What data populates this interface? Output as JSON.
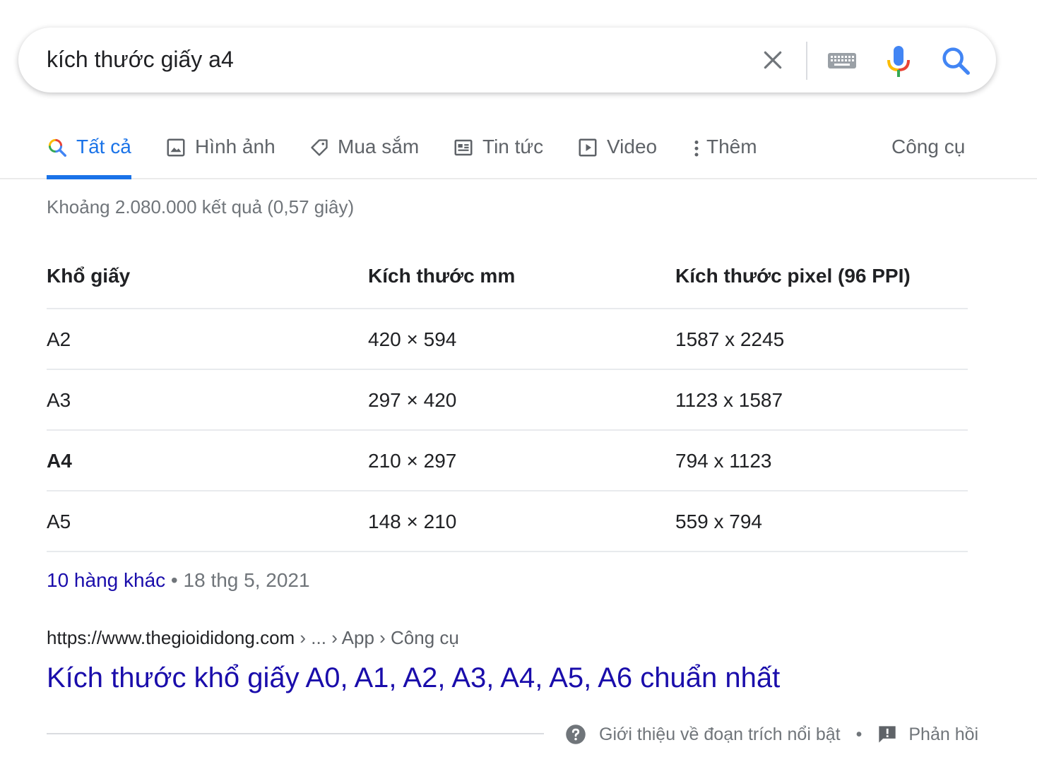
{
  "search": {
    "query": "kích thước giấy a4"
  },
  "icons": {
    "clear": "close-icon",
    "keyboard": "keyboard-icon",
    "mic": "microphone-icon",
    "search": "search-icon"
  },
  "colors": {
    "accent": "#1a73e8",
    "link": "#1a0dab",
    "muted": "#70757a",
    "mic_red": "#ea4335",
    "mic_blue": "#4285f4",
    "mic_green": "#34a853",
    "mic_yellow": "#fbbc05"
  },
  "tabs": [
    {
      "label": "Tất cả",
      "icon": "search-icon",
      "active": true
    },
    {
      "label": "Hình ảnh",
      "icon": "image-icon"
    },
    {
      "label": "Mua sắm",
      "icon": "tag-icon"
    },
    {
      "label": "Tin tức",
      "icon": "news-icon"
    },
    {
      "label": "Video",
      "icon": "play-icon"
    },
    {
      "label": "Thêm",
      "icon": "more-vert-icon"
    },
    {
      "label": "Công cụ"
    }
  ],
  "stats": "Khoảng 2.080.000 kết quả (0,57 giây)",
  "table": {
    "headers": [
      "Khổ giấy",
      "Kích thước mm",
      "Kích thước pixel (96 PPI)"
    ],
    "rows": [
      [
        "A2",
        "420 × 594",
        "1587 x 2245"
      ],
      [
        "A3",
        "297 × 420",
        "1123 x 1587"
      ],
      [
        "A4",
        "210 × 297",
        "794 x 1123"
      ],
      [
        "A5",
        "148 × 210",
        "559 x 794"
      ]
    ]
  },
  "more_rows": {
    "link": "10 hàng khác",
    "separator": "•",
    "date": "18 thg 5, 2021"
  },
  "result": {
    "url": "https://www.thegioididong.com",
    "breadcrumbs": " › ... › App › Công cụ",
    "title": "Kích thước khổ giấy A0, A1, A2, A3, A4, A5, A6 chuẩn nhất"
  },
  "footer": {
    "about": "Giới thiệu về đoạn trích nổi bật",
    "separator": "•",
    "feedback": "Phản hồi"
  }
}
